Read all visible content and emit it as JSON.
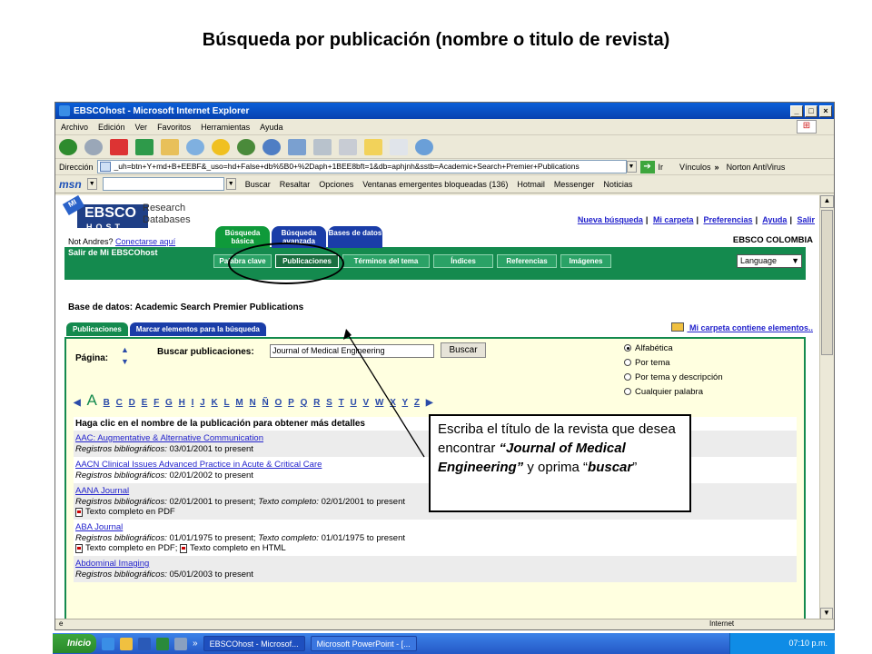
{
  "slide": {
    "title": "Búsqueda por publicación (nombre o titulo de revista)",
    "callout_text": "Escriba  el título de la revista que desea encontrar",
    "callout_title": "“Journal of Medical Engineering”",
    "callout_y": "y oprima  “",
    "callout_buscar": "buscar",
    "callout_end": "”"
  },
  "window": {
    "title": "EBSCOhost - Microsoft Internet Explorer",
    "menu": [
      "Archivo",
      "Edición",
      "Ver",
      "Favoritos",
      "Herramientas",
      "Ayuda"
    ],
    "address_label": "Dirección",
    "address_url": "_uh=btn+Y+md+B+EEBF&_uso=hd+False+db%5B0+%2Daph+1BEE8bft=1&db=aphjnh&sstb=Academic+Search+Premier+Publications",
    "go_label": "Ir",
    "links_label": "Vínculos",
    "norton_label": "Norton AntiVirus",
    "msn_logo": "msn",
    "msn_buscar": "Buscar",
    "msn_resaltar": "Resaltar",
    "msn_opciones": "Opciones",
    "msn_popups": "Ventanas emergentes bloqueadas (136)",
    "msn_hotmail": "Hotmail",
    "msn_messenger": "Messenger",
    "msn_noticias": "Noticias",
    "status_zone": "Internet"
  },
  "ebsco": {
    "logo_mi": "MI",
    "logo_text": "EBSCO",
    "logo_host": "HOST",
    "research": "Research",
    "databases": "Databases",
    "not_user": "Not Andres?",
    "login_link": "Conectarse aquí",
    "salir": "Salir de Mi EBSCOhost",
    "links": [
      "Nueva búsqueda",
      "Mi carpeta",
      "Preferencias",
      "Ayuda",
      "Salir"
    ],
    "country": "EBSCO COLOMBIA",
    "main_tabs": [
      "Búsqueda básica",
      "Búsqueda avanzada",
      "Bases de datos"
    ],
    "sub_tabs": [
      "Palabra clave",
      "Publicaciones",
      "Términos del tema",
      "Índices",
      "Referencias",
      "Imágenes"
    ],
    "language": "Language",
    "base_title": "Base de datos: Academic Search Premier Publications",
    "pub_tabs": [
      "Publicaciones",
      "Marcar elementos para la búsqueda"
    ],
    "carpeta_msg": "Mi carpeta contiene elementos..",
    "pagina_label": "Página:",
    "buscar_label": "Buscar publicaciones:",
    "search_value": "Journal of Medical Engineering",
    "buscar_button": "Buscar",
    "radio_options": [
      "Alfabética",
      "Por tema",
      "Por tema y descripción",
      "Cualquier palabra"
    ],
    "alpha_current": "A",
    "alpha_letters": [
      "B",
      "C",
      "D",
      "E",
      "F",
      "G",
      "H",
      "I",
      "J",
      "K",
      "L",
      "M",
      "N",
      "Ñ",
      "O",
      "P",
      "Q",
      "R",
      "S",
      "T",
      "U",
      "V",
      "W",
      "X",
      "Y",
      "Z"
    ],
    "instructions": "Haga clic en el nombre de la publicación para obtener más detalles",
    "registros_label": "Registros bibliográficos:",
    "texto_label": "Texto completo:",
    "results": [
      {
        "title": "AAC: Augmentative & Alternative Communication",
        "registros": "03/01/2001 to present"
      },
      {
        "title": "AACN Clinical Issues Advanced Practice in Acute & Critical Care",
        "registros": "02/01/2002 to present"
      },
      {
        "title": "AANA Journal",
        "registros": "02/01/2001 to present;",
        "texto": "02/01/2001 to present",
        "formats": "Texto completo en PDF"
      },
      {
        "title": "ABA Journal",
        "registros": "01/01/1975 to present;",
        "texto": "01/01/1975 to present",
        "formats": "Texto completo en PDF;",
        "formats2": "Texto completo en HTML"
      },
      {
        "title": "Abdominal Imaging",
        "registros": "05/01/2003 to present"
      }
    ]
  },
  "taskbar": {
    "start": "Inicio",
    "items": [
      "EBSCOhost - Microsof...",
      "Microsoft PowerPoint - [..."
    ],
    "clock": "07:10 p.m."
  },
  "colors": {
    "ebsco_green": "#148a4e",
    "ebsco_blue": "#1f3f86",
    "tab_green": "#0f9a3a",
    "tab_blue": "#1a3da8",
    "link_blue": "#2222cc",
    "panel_yellow": "#ffffe0"
  }
}
